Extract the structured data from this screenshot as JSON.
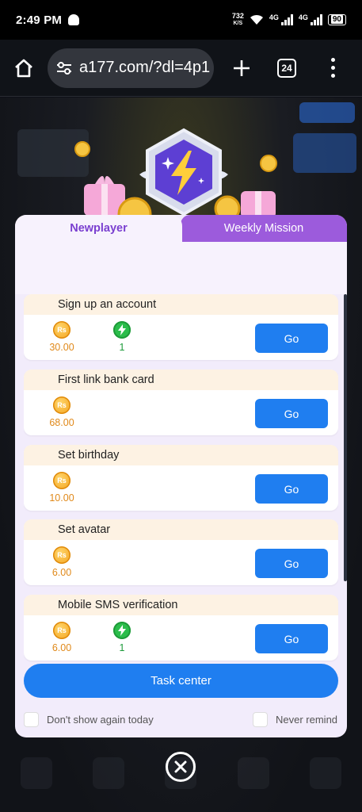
{
  "status_bar": {
    "time": "2:49 PM",
    "speed_value": "732",
    "speed_unit": "K/S",
    "network1": "4G",
    "network2": "4G",
    "battery": "90"
  },
  "browser": {
    "url": "a177.com/?dl=4p1",
    "tab_count": "24"
  },
  "modal": {
    "tabs": [
      {
        "label": "Newplayer",
        "active": true
      },
      {
        "label": "Weekly Mission",
        "active": false
      }
    ],
    "tasks": [
      {
        "title": "Sign up an account",
        "coin_label": "Rs",
        "coin_value": "30.00",
        "bolt_value": "1",
        "action": "Go"
      },
      {
        "title": "First link bank card",
        "coin_label": "Rs",
        "coin_value": "68.00",
        "action": "Go"
      },
      {
        "title": "Set birthday",
        "coin_label": "Rs",
        "coin_value": "10.00",
        "action": "Go"
      },
      {
        "title": "Set avatar",
        "coin_label": "Rs",
        "coin_value": "6.00",
        "action": "Go"
      },
      {
        "title": "Mobile SMS verification",
        "coin_label": "Rs",
        "coin_value": "6.00",
        "bolt_value": "1",
        "action": "Go"
      }
    ],
    "task_center_label": "Task center",
    "dont_show_label": "Don't show again today",
    "never_remind_label": "Never remind"
  },
  "colors": {
    "primary_blue": "#1f7ef0",
    "active_tab_text": "#7a3fd0",
    "inactive_tab_bg": "#9c5bdc",
    "coin_orange": "#e0891a",
    "bolt_green": "#2bbd4b"
  }
}
